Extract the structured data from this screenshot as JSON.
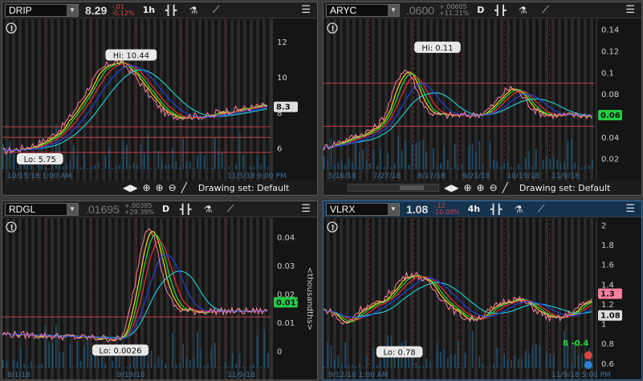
{
  "panels": [
    {
      "symbol": "DRIP",
      "price": "8.29",
      "price_dim": false,
      "change": "-.01",
      "change_pct": "-0.12%",
      "change_up": false,
      "timeframe": "1h",
      "hi_label": "Hi: 10.44",
      "lo_label": "Lo: 5.75",
      "last_tag": "8.3",
      "last_tag_color": "#dddddd",
      "axis": [
        "12",
        "10",
        "8",
        "6"
      ],
      "x_labels": [
        "10/15/18 1:00 AM",
        "11/5/18 9:00 PM"
      ],
      "drawing_set": "Drawing set: Default",
      "has_scroll": false,
      "hi_val": 10.44,
      "lo_val": 5.75,
      "min": 4.8,
      "max": 13.0,
      "last": 8.3,
      "lines": [
        7.2,
        6.6,
        5.75
      ],
      "pattern": "drip",
      "accent": "#d04040"
    },
    {
      "symbol": "ARYC",
      "price": ".0600",
      "price_dim": true,
      "change": "+.00605",
      "change_pct": "+11.21%",
      "change_up": true,
      "timeframe": "D",
      "hi_label": "Hi: 0.11",
      "lo_label": "",
      "last_tag": "0.06",
      "last_tag_color": "#22cc44",
      "axis": [
        "0.14",
        "0.12",
        "0.1",
        "0.08",
        "0.06",
        "0.04",
        "0.02"
      ],
      "x_labels": [
        "5/16/18",
        "7/27/18",
        "8/17/18",
        "9/21/18",
        "10/19/18",
        "11/9/18"
      ],
      "drawing_set": "Drawing set: Default",
      "has_scroll": true,
      "hi_val": 0.11,
      "lo_val": 0.04,
      "min": 0.01,
      "max": 0.145,
      "last": 0.06,
      "lines": [
        0.09,
        0.05
      ],
      "pattern": "aryc",
      "accent": "#d04040"
    },
    {
      "symbol": "RDGL",
      "price": ".01695",
      "price_dim": true,
      "change": "+.00385",
      "change_pct": "+29.39%",
      "change_up": true,
      "timeframe": "D",
      "hi_label": "",
      "lo_label": "Lo: 0.0026",
      "last_tag": "0.017",
      "last_tag_color": "#22cc44",
      "axis": [
        "0.04",
        "0.03",
        "0.02",
        "0.01",
        "0"
      ],
      "side_label": "<thousandths>",
      "x_labels": [
        "8/1/18",
        "9/19/18",
        "11/9/18"
      ],
      "drawing_set": "",
      "has_scroll": false,
      "hi_val": 0.039,
      "lo_val": 0.0026,
      "min": -0.006,
      "max": 0.045,
      "last": 0.017,
      "lines": [
        0.012
      ],
      "pattern": "rdgl",
      "accent": "#d04040"
    },
    {
      "symbol": "VLRX",
      "price": "1.08",
      "price_dim": false,
      "change": "-.12",
      "change_pct": "-10.00%",
      "change_up": false,
      "timeframe": "4h",
      "hi_label": "",
      "lo_label": "Lo: 0.78",
      "last_tag": "1.08",
      "last_tag_color": "#dddddd",
      "last_tag2": "1.3",
      "axis": [
        "2",
        "1.8",
        "1.6",
        "1.4",
        "1.2",
        "1",
        "0.8",
        "0.6"
      ],
      "x_labels": [
        "9/12/18 1:00 AM",
        "11/9/18 5:00 PM"
      ],
      "drawing_set": "",
      "has_scroll": false,
      "hi_val": 1.7,
      "lo_val": 0.78,
      "min": 0.55,
      "max": 2.02,
      "last": 1.08,
      "lines": [],
      "pattern": "vlrx",
      "accent": "#d04040",
      "corner_badge": "8 -0.4"
    }
  ]
}
